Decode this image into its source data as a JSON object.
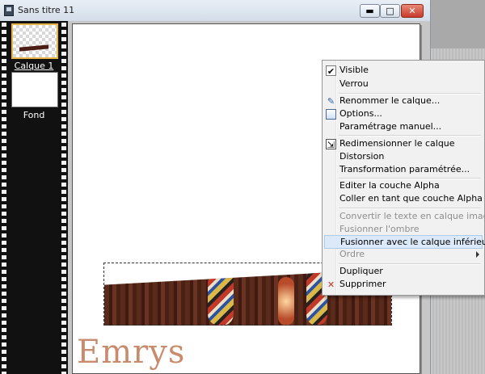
{
  "window": {
    "title": "Sans titre 11",
    "buttons": {
      "minimize": "▬",
      "maximize": "□",
      "close": "✕"
    }
  },
  "layers": [
    {
      "name": "Calque 1",
      "selected": true
    },
    {
      "name": "Fond",
      "selected": false
    }
  ],
  "watermark": "Emrys",
  "context_menu": {
    "items": [
      {
        "label": "Visible",
        "icon": "check-icon",
        "disabled": false
      },
      {
        "label": "Verrou",
        "icon": "",
        "disabled": false
      },
      {
        "label": "Renommer le calque...",
        "icon": "pencil-icon",
        "disabled": false
      },
      {
        "label": "Options...",
        "icon": "options-icon",
        "disabled": false
      },
      {
        "label": "Paramétrage manuel...",
        "icon": "",
        "disabled": false
      },
      {
        "label": "Redimensionner le calque",
        "icon": "resize-icon",
        "disabled": false
      },
      {
        "label": "Distorsion",
        "icon": "",
        "disabled": false
      },
      {
        "label": "Transformation paramétrée...",
        "icon": "",
        "disabled": false
      },
      {
        "label": "Editer la couche Alpha",
        "icon": "",
        "disabled": false
      },
      {
        "label": "Coller en tant que couche Alpha",
        "icon": "",
        "disabled": false
      },
      {
        "label": "Convertir le texte en calque image",
        "icon": "",
        "disabled": true
      },
      {
        "label": "Fusionner l'ombre",
        "icon": "",
        "disabled": true
      },
      {
        "label": "Fusionner avec le calque inférieur",
        "icon": "",
        "disabled": false,
        "highlighted": true
      },
      {
        "label": "Ordre",
        "icon": "",
        "disabled": true,
        "submenu": true
      },
      {
        "label": "Dupliquer",
        "icon": "",
        "disabled": false
      },
      {
        "label": "Supprimer",
        "icon": "delete-x-icon",
        "disabled": false
      }
    ]
  },
  "colors": {
    "selected_layer_border": "#e6b54a",
    "menu_highlight": "#dbe9f8",
    "close_button": "#c8392a",
    "watermark": "#c98b6e"
  }
}
